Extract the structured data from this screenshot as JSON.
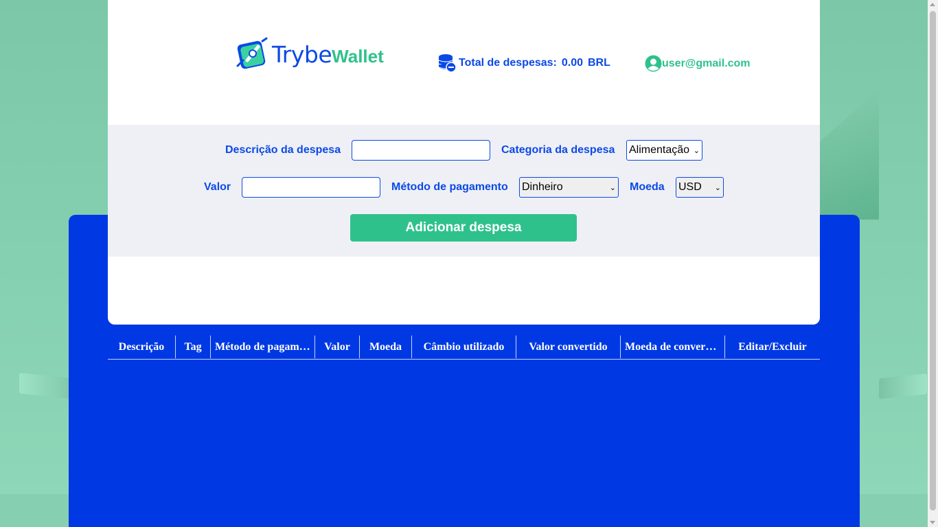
{
  "brand": {
    "name_part1": "Trybe",
    "name_part2": "Wallet"
  },
  "header": {
    "total_label": "Total de despesas:",
    "total_value": "0.00",
    "total_currency": "BRL",
    "user_email": "user@gmail.com"
  },
  "form": {
    "description_label": "Descrição da despesa",
    "description_value": "",
    "category_label": "Categoria da despesa",
    "category_selected": "Alimentação",
    "value_label": "Valor",
    "value_value": "",
    "payment_label": "Método de pagamento",
    "payment_selected": "Dinheiro",
    "currency_label": "Moeda",
    "currency_selected": "USD",
    "submit_label": "Adicionar despesa"
  },
  "table": {
    "headers": [
      "Descrição",
      "Tag",
      "Método de pagamento",
      "Valor",
      "Moeda",
      "Câmbio utilizado",
      "Valor convertido",
      "Moeda de conversão",
      "Editar/Excluir"
    ]
  },
  "colors": {
    "primary_blue": "#0039e3",
    "text_blue": "#0b49e6",
    "accent_green": "#2fc18c",
    "form_bg": "#eff0f5"
  },
  "icons": {
    "logo": "wallet-logo-icon",
    "coins": "coins-icon",
    "user": "user-avatar-icon"
  }
}
